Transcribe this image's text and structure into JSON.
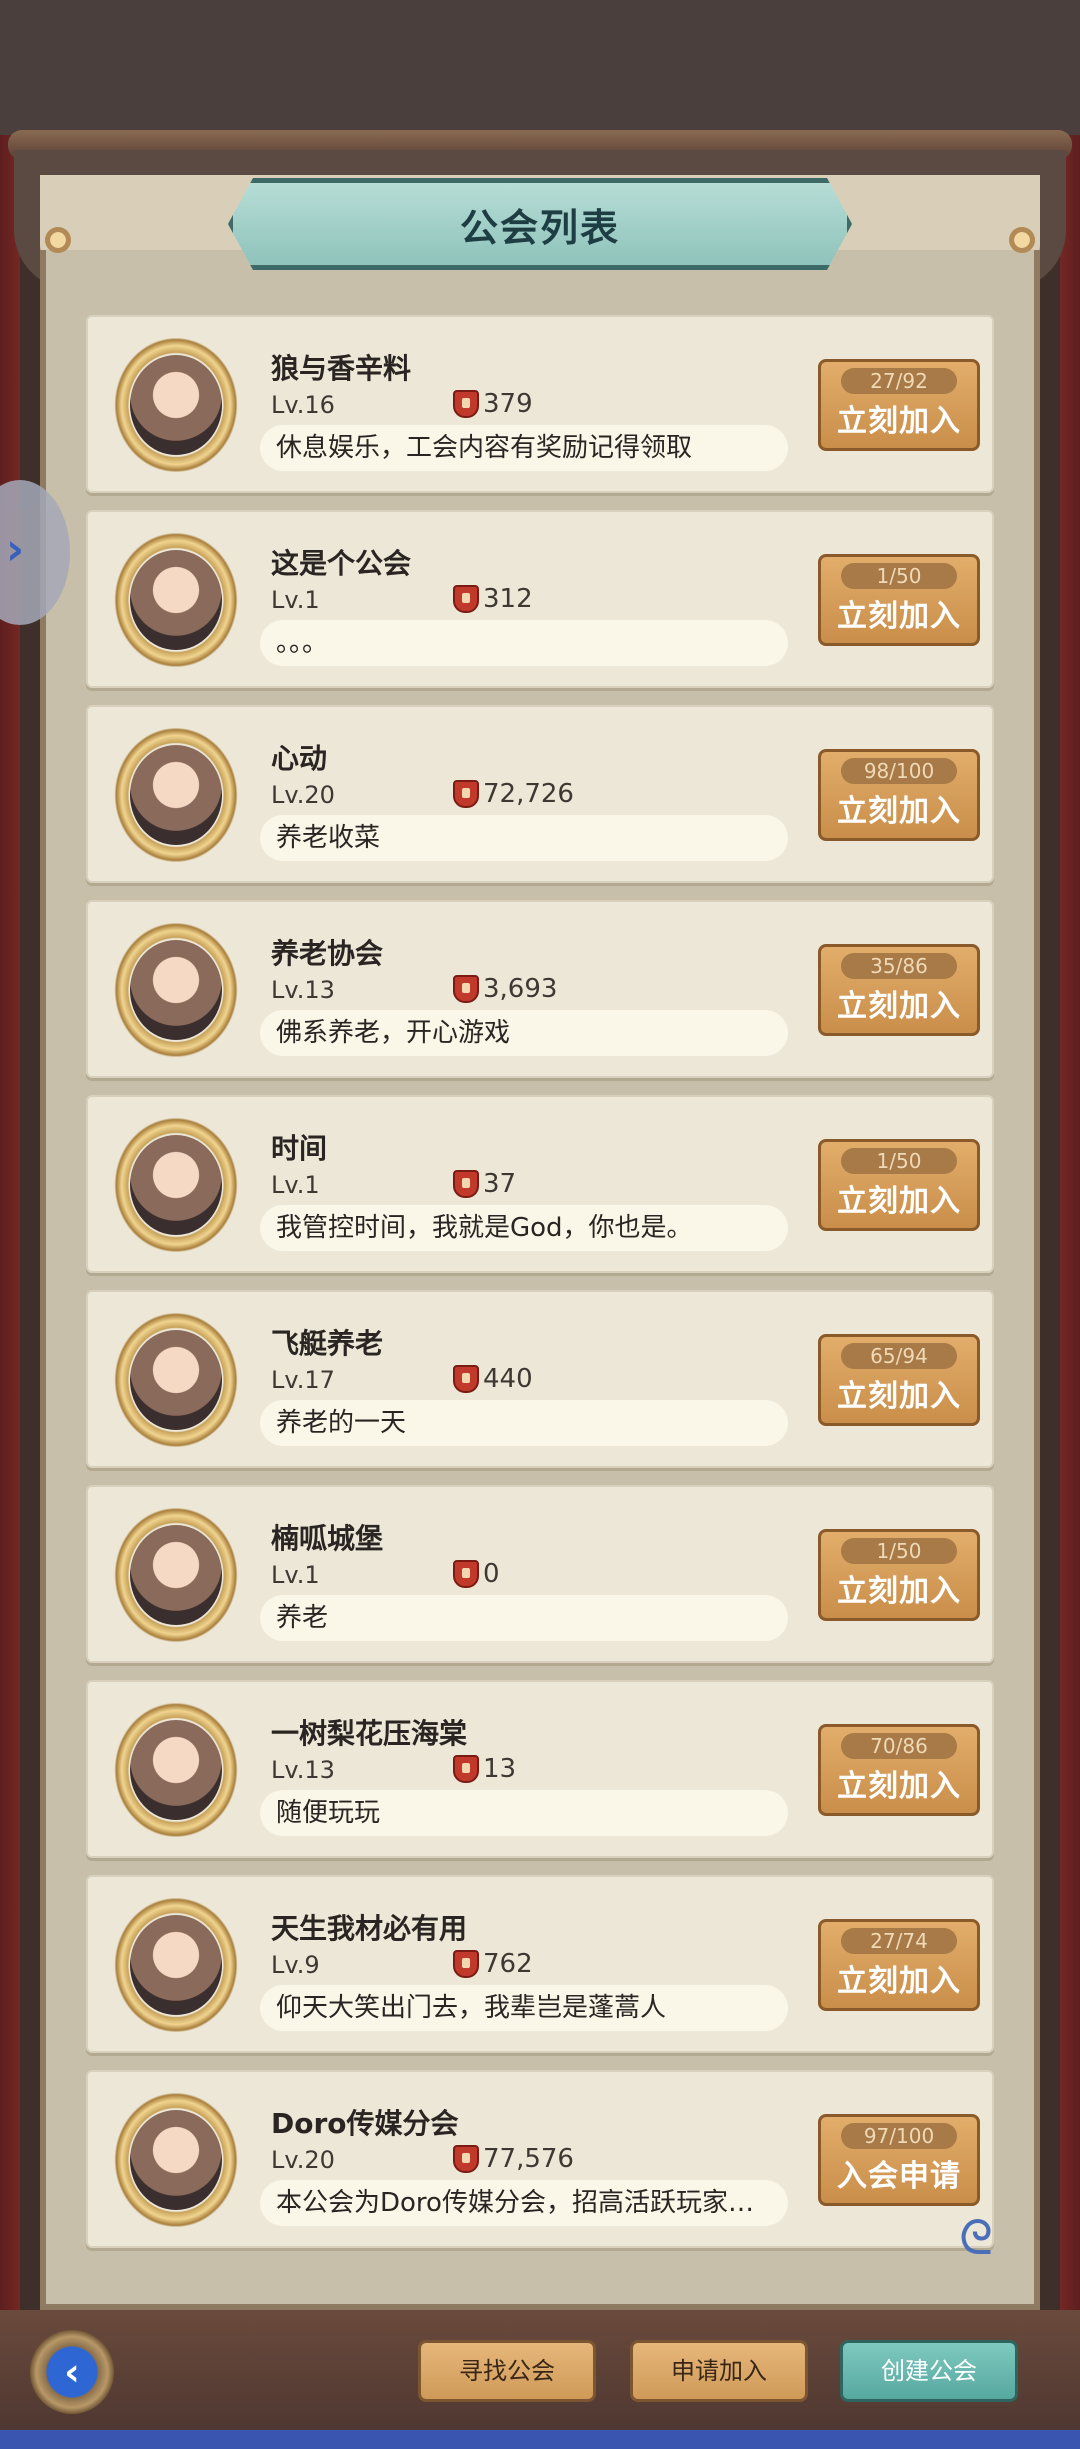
{
  "header": {
    "title": "公会列表"
  },
  "guilds": [
    {
      "name": "狼与香辛料",
      "level": "Lv.16",
      "power": "379",
      "desc": "休息娱乐，工会内容有奖励记得领取",
      "members": "27/92",
      "action": "立刻加入"
    },
    {
      "name": "这是个公会",
      "level": "Lv.1",
      "power": "312",
      "desc": "。。。",
      "members": "1/50",
      "action": "立刻加入"
    },
    {
      "name": "心动",
      "level": "Lv.20",
      "power": "72,726",
      "desc": "养老收菜",
      "members": "98/100",
      "action": "立刻加入"
    },
    {
      "name": "养老协会",
      "level": "Lv.13",
      "power": "3,693",
      "desc": "佛系养老，开心游戏",
      "members": "35/86",
      "action": "立刻加入"
    },
    {
      "name": "时间",
      "level": "Lv.1",
      "power": "37",
      "desc": "我管控时间，我就是God，你也是。",
      "members": "1/50",
      "action": "立刻加入"
    },
    {
      "name": "飞艇养老",
      "level": "Lv.17",
      "power": "440",
      "desc": "养老的一天",
      "members": "65/94",
      "action": "立刻加入"
    },
    {
      "name": "楠呱城堡",
      "level": "Lv.1",
      "power": "0",
      "desc": "养老",
      "members": "1/50",
      "action": "立刻加入"
    },
    {
      "name": "一树梨花压海棠",
      "level": "Lv.13",
      "power": "13",
      "desc": "随便玩玩",
      "members": "70/86",
      "action": "立刻加入"
    },
    {
      "name": "天生我材必有用",
      "level": "Lv.9",
      "power": "762",
      "desc": "仰天大笑出门去，我辈岂是蓬蒿人",
      "members": "27/74",
      "action": "立刻加入"
    },
    {
      "name": "Doro传媒分会",
      "level": "Lv.20",
      "power": "77,576",
      "desc": "本公会为Doro传媒分会，招高活跃玩家…",
      "members": "97/100",
      "action": "入会申请"
    }
  ],
  "footer": {
    "find": "寻找公会",
    "apply": "申请加入",
    "create": "创建公会"
  },
  "icons": {
    "power": "shield-icon",
    "back": "back-arrow-icon",
    "side": "chevron-right-icon",
    "swirl": "chat-swirl-icon"
  },
  "colors": {
    "accent_teal": "#56a89f",
    "button_brown": "#cf9a58",
    "card_bg": "#ece7d7"
  }
}
